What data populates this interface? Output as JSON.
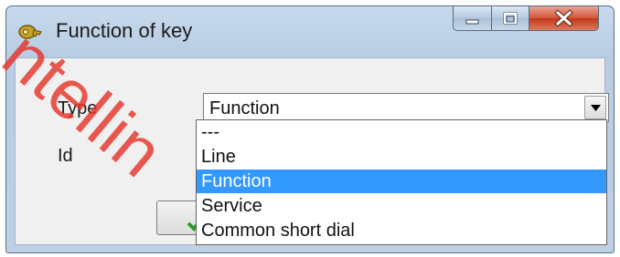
{
  "window": {
    "title": "Function of key",
    "icons": {
      "app": "key-icon",
      "minimize": "minimize-icon",
      "maximize": "maximize-icon",
      "close": "close-icon"
    }
  },
  "form": {
    "type_label": "Type",
    "id_label": "Id",
    "type_value": "Function"
  },
  "dropdown": {
    "options": [
      "---",
      "Line",
      "Function",
      "Service",
      "Common short dial"
    ],
    "selected": "Function"
  },
  "ok_button": {
    "icon": "checkmark-icon"
  },
  "watermark": {
    "text": "ntellin",
    "color": "#e5332a"
  },
  "colors": {
    "selection": "#3399ff",
    "close_button": "#c8412a",
    "checkmark": "#2e9a2e"
  }
}
